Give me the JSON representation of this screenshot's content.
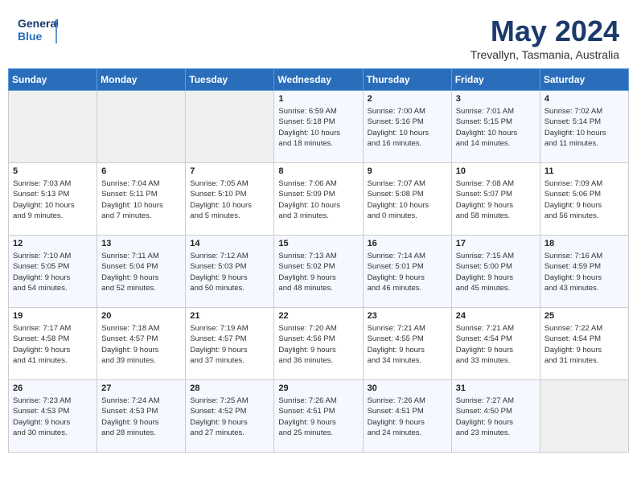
{
  "header": {
    "logo_line1": "General",
    "logo_line2": "Blue",
    "month": "May 2024",
    "location": "Trevallyn, Tasmania, Australia"
  },
  "weekdays": [
    "Sunday",
    "Monday",
    "Tuesday",
    "Wednesday",
    "Thursday",
    "Friday",
    "Saturday"
  ],
  "weeks": [
    [
      {
        "day": "",
        "info": ""
      },
      {
        "day": "",
        "info": ""
      },
      {
        "day": "",
        "info": ""
      },
      {
        "day": "1",
        "info": "Sunrise: 6:59 AM\nSunset: 5:18 PM\nDaylight: 10 hours\nand 18 minutes."
      },
      {
        "day": "2",
        "info": "Sunrise: 7:00 AM\nSunset: 5:16 PM\nDaylight: 10 hours\nand 16 minutes."
      },
      {
        "day": "3",
        "info": "Sunrise: 7:01 AM\nSunset: 5:15 PM\nDaylight: 10 hours\nand 14 minutes."
      },
      {
        "day": "4",
        "info": "Sunrise: 7:02 AM\nSunset: 5:14 PM\nDaylight: 10 hours\nand 11 minutes."
      }
    ],
    [
      {
        "day": "5",
        "info": "Sunrise: 7:03 AM\nSunset: 5:13 PM\nDaylight: 10 hours\nand 9 minutes."
      },
      {
        "day": "6",
        "info": "Sunrise: 7:04 AM\nSunset: 5:11 PM\nDaylight: 10 hours\nand 7 minutes."
      },
      {
        "day": "7",
        "info": "Sunrise: 7:05 AM\nSunset: 5:10 PM\nDaylight: 10 hours\nand 5 minutes."
      },
      {
        "day": "8",
        "info": "Sunrise: 7:06 AM\nSunset: 5:09 PM\nDaylight: 10 hours\nand 3 minutes."
      },
      {
        "day": "9",
        "info": "Sunrise: 7:07 AM\nSunset: 5:08 PM\nDaylight: 10 hours\nand 0 minutes."
      },
      {
        "day": "10",
        "info": "Sunrise: 7:08 AM\nSunset: 5:07 PM\nDaylight: 9 hours\nand 58 minutes."
      },
      {
        "day": "11",
        "info": "Sunrise: 7:09 AM\nSunset: 5:06 PM\nDaylight: 9 hours\nand 56 minutes."
      }
    ],
    [
      {
        "day": "12",
        "info": "Sunrise: 7:10 AM\nSunset: 5:05 PM\nDaylight: 9 hours\nand 54 minutes."
      },
      {
        "day": "13",
        "info": "Sunrise: 7:11 AM\nSunset: 5:04 PM\nDaylight: 9 hours\nand 52 minutes."
      },
      {
        "day": "14",
        "info": "Sunrise: 7:12 AM\nSunset: 5:03 PM\nDaylight: 9 hours\nand 50 minutes."
      },
      {
        "day": "15",
        "info": "Sunrise: 7:13 AM\nSunset: 5:02 PM\nDaylight: 9 hours\nand 48 minutes."
      },
      {
        "day": "16",
        "info": "Sunrise: 7:14 AM\nSunset: 5:01 PM\nDaylight: 9 hours\nand 46 minutes."
      },
      {
        "day": "17",
        "info": "Sunrise: 7:15 AM\nSunset: 5:00 PM\nDaylight: 9 hours\nand 45 minutes."
      },
      {
        "day": "18",
        "info": "Sunrise: 7:16 AM\nSunset: 4:59 PM\nDaylight: 9 hours\nand 43 minutes."
      }
    ],
    [
      {
        "day": "19",
        "info": "Sunrise: 7:17 AM\nSunset: 4:58 PM\nDaylight: 9 hours\nand 41 minutes."
      },
      {
        "day": "20",
        "info": "Sunrise: 7:18 AM\nSunset: 4:57 PM\nDaylight: 9 hours\nand 39 minutes."
      },
      {
        "day": "21",
        "info": "Sunrise: 7:19 AM\nSunset: 4:57 PM\nDaylight: 9 hours\nand 37 minutes."
      },
      {
        "day": "22",
        "info": "Sunrise: 7:20 AM\nSunset: 4:56 PM\nDaylight: 9 hours\nand 36 minutes."
      },
      {
        "day": "23",
        "info": "Sunrise: 7:21 AM\nSunset: 4:55 PM\nDaylight: 9 hours\nand 34 minutes."
      },
      {
        "day": "24",
        "info": "Sunrise: 7:21 AM\nSunset: 4:54 PM\nDaylight: 9 hours\nand 33 minutes."
      },
      {
        "day": "25",
        "info": "Sunrise: 7:22 AM\nSunset: 4:54 PM\nDaylight: 9 hours\nand 31 minutes."
      }
    ],
    [
      {
        "day": "26",
        "info": "Sunrise: 7:23 AM\nSunset: 4:53 PM\nDaylight: 9 hours\nand 30 minutes."
      },
      {
        "day": "27",
        "info": "Sunrise: 7:24 AM\nSunset: 4:53 PM\nDaylight: 9 hours\nand 28 minutes."
      },
      {
        "day": "28",
        "info": "Sunrise: 7:25 AM\nSunset: 4:52 PM\nDaylight: 9 hours\nand 27 minutes."
      },
      {
        "day": "29",
        "info": "Sunrise: 7:26 AM\nSunset: 4:51 PM\nDaylight: 9 hours\nand 25 minutes."
      },
      {
        "day": "30",
        "info": "Sunrise: 7:26 AM\nSunset: 4:51 PM\nDaylight: 9 hours\nand 24 minutes."
      },
      {
        "day": "31",
        "info": "Sunrise: 7:27 AM\nSunset: 4:50 PM\nDaylight: 9 hours\nand 23 minutes."
      },
      {
        "day": "",
        "info": ""
      }
    ]
  ]
}
